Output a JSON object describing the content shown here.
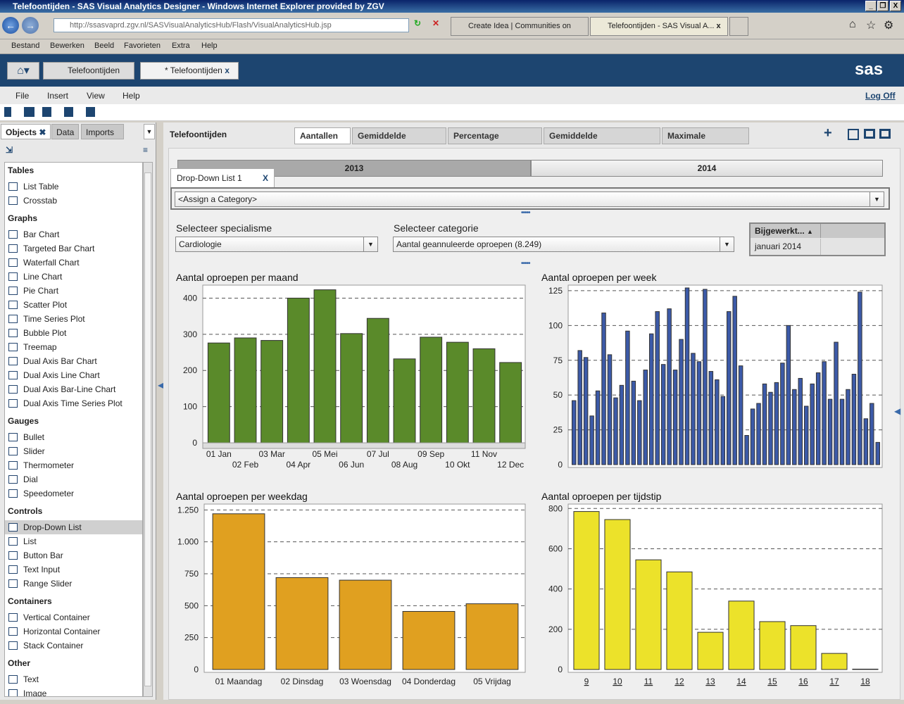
{
  "browser": {
    "title": "Telefoontijden - SAS Visual Analytics Designer - Windows Internet Explorer provided by ZGV",
    "url": "http://ssasvaprd.zgv.nl/SASVisualAnalyticsHub/Flash/VisualAnalyticsHub.jsp",
    "tabs": [
      {
        "label": "Create Idea | Communities on SAS"
      },
      {
        "label": "Telefoontijden - SAS Visual A...",
        "close": "x"
      }
    ],
    "menu": [
      "Bestand",
      "Bewerken",
      "Beeld",
      "Favorieten",
      "Extra",
      "Help"
    ]
  },
  "sas": {
    "tabs": [
      {
        "label": "Telefoontijden"
      },
      {
        "label": "* Telefoontijden"
      }
    ],
    "logo": "sas",
    "close": "x",
    "menu": [
      "File",
      "Insert",
      "View",
      "Help"
    ],
    "logoff": "Log Off"
  },
  "left": {
    "tabs": [
      "Objects",
      "Data",
      "Imports"
    ],
    "groups": [
      {
        "label": "Tables",
        "items": [
          "List Table",
          "Crosstab"
        ]
      },
      {
        "label": "Graphs",
        "items": [
          "Bar Chart",
          "Targeted Bar Chart",
          "Waterfall Chart",
          "Line Chart",
          "Pie Chart",
          "Scatter Plot",
          "Time Series Plot",
          "Bubble Plot",
          "Treemap",
          "Dual Axis Bar Chart",
          "Dual Axis Line Chart",
          "Dual Axis Bar-Line Chart",
          "Dual Axis Time Series Plot"
        ]
      },
      {
        "label": "Gauges",
        "items": [
          "Bullet",
          "Slider",
          "Thermometer",
          "Dial",
          "Speedometer"
        ]
      },
      {
        "label": "Controls",
        "items": [
          "Drop-Down List",
          "List",
          "Button Bar",
          "Text Input",
          "Range Slider"
        ]
      },
      {
        "label": "Containers",
        "items": [
          "Vertical Container",
          "Horizontal Container",
          "Stack Container"
        ]
      },
      {
        "label": "Other",
        "items": [
          "Text",
          "Image"
        ]
      }
    ],
    "selected": "Drop-Down List"
  },
  "report": {
    "title": "Telefoontijden",
    "tabs": [
      "Aantallen",
      "Gemiddelde wachttijd",
      "Percentage annuleer",
      "Gemiddelde gespreksduur",
      "Maximale wachttijd"
    ],
    "year_buttons": [
      "2013",
      "2014"
    ],
    "dropdown_tab": "Drop-Down List 1",
    "dropdown_close": "X",
    "dropdown_value": "<Assign a Category>",
    "spec_label": "Selecteer specialisme",
    "spec_value": "Cardiologie",
    "cat_label": "Selecteer categorie",
    "cat_value": "Aantal geannuleerde oproepen (8.249)",
    "table_header": "Bijgewerkt...",
    "table_sort": "▲",
    "table_value": "januari 2014",
    "colors": {
      "green": "#5a8a2a",
      "blue": "#3c5aa8",
      "orange": "#e0a020",
      "yellow": "#ece22a"
    }
  },
  "chart_data": [
    {
      "type": "bar",
      "title": "Aantal oproepen per maand",
      "categories": [
        "01 Jan",
        "02 Feb",
        "03 Mar",
        "04 Apr",
        "05 Mei",
        "06 Jun",
        "07 Jul",
        "08 Aug",
        "09 Sep",
        "10 Okt",
        "11 Nov",
        "12 Dec"
      ],
      "values": [
        276,
        290,
        283,
        400,
        423,
        302,
        344,
        232,
        292,
        278,
        260,
        222
      ],
      "yticks": [
        0,
        100,
        200,
        300,
        400
      ],
      "ytick_labels": [
        "0",
        "100",
        "200",
        "300",
        "400"
      ],
      "ylim": [
        0,
        432
      ],
      "color": "#5a8a2a",
      "grid": true
    },
    {
      "type": "bar",
      "title": "Aantal oproepen per week",
      "categories": [],
      "values": [
        46,
        82,
        77,
        35,
        53,
        109,
        79,
        48,
        57,
        96,
        60,
        46,
        68,
        94,
        110,
        72,
        112,
        68,
        90,
        127,
        80,
        74,
        126,
        67,
        61,
        49,
        110,
        121,
        71,
        21,
        40,
        44,
        58,
        52,
        59,
        73,
        100,
        54,
        62,
        42,
        58,
        66,
        74,
        47,
        88,
        47,
        54,
        65,
        124,
        33,
        44,
        16
      ],
      "yticks": [
        0,
        25,
        50,
        75,
        100,
        125
      ],
      "ytick_labels": [
        "0",
        "25",
        "50",
        "75",
        "100",
        "125"
      ],
      "ylim": [
        0,
        128
      ],
      "color": "#3c5aa8",
      "grid": true
    },
    {
      "type": "bar",
      "title": "Aantal oproepen per weekdag",
      "categories": [
        "01 Maandag",
        "02 Dinsdag",
        "03 Woensdag",
        "04 Donderdag",
        "05 Vrijdag"
      ],
      "values": [
        1220,
        720,
        700,
        455,
        515
      ],
      "yticks": [
        0,
        250,
        500,
        750,
        1000,
        1250
      ],
      "ytick_labels": [
        "0",
        "250",
        "500",
        "750",
        "1.000",
        "1.250"
      ],
      "ylim": [
        0,
        1285
      ],
      "color": "#e0a020",
      "grid": true
    },
    {
      "type": "bar",
      "title": "Aantal oproepen per tijdstip",
      "categories": [
        "9",
        "10",
        "11",
        "12",
        "13",
        "14",
        "15",
        "16",
        "17",
        "18"
      ],
      "values": [
        785,
        745,
        545,
        485,
        185,
        340,
        238,
        218,
        80,
        2
      ],
      "yticks": [
        0,
        200,
        400,
        600,
        800
      ],
      "ytick_labels": [
        "0",
        "200",
        "400",
        "600",
        "800"
      ],
      "ylim": [
        0,
        815
      ],
      "color": "#ece22a",
      "grid": true
    }
  ]
}
